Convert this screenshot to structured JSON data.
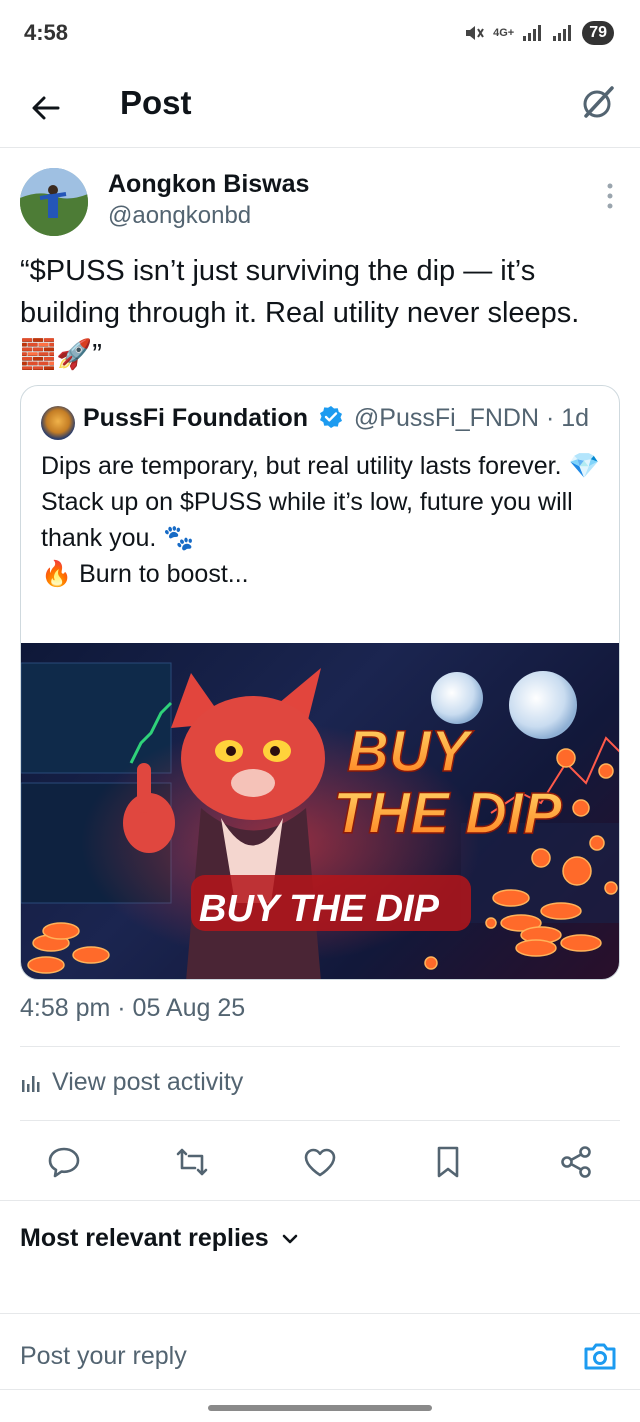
{
  "status_bar": {
    "time": "4:58",
    "network": "4G+",
    "battery": "79"
  },
  "header": {
    "title": "Post"
  },
  "post": {
    "author_name": "Aongkon Biswas",
    "author_handle": "@aongkonbd",
    "text": "“$PUSS isn’t just surviving the dip — it’s building through it. Real utility never sleeps. 🧱🚀”",
    "timestamp": "4:58 pm · 05 Aug 25"
  },
  "quoted_post": {
    "author_name": "PussFi Foundation",
    "author_handle": "@PussFi_FNDN",
    "age": "· 1d",
    "lines": [
      "Dips are temporary, but real utility lasts forever. 💎",
      "Stack up on $PUSS while it’s low, future you will thank you. 🐾",
      "🔥 Burn to boost..."
    ],
    "image": {
      "headline_line1": "BUY",
      "headline_line2": "THE DIP",
      "banner_text": "BUY THE DIP"
    }
  },
  "activity": {
    "label": "View post activity"
  },
  "replies": {
    "sort_label": "Most relevant replies"
  },
  "reply_input": {
    "placeholder": "Post your reply"
  },
  "colors": {
    "text_primary": "#0f1419",
    "text_secondary": "#536471",
    "accent": "#1d9bf0",
    "divider": "#e6e8ea"
  },
  "icons": {
    "back": "arrow-left-icon",
    "grok": "grok-icon",
    "more": "more-vertical-icon",
    "verified": "verified-badge-icon",
    "activity": "bar-chart-icon",
    "reply": "reply-icon",
    "repost": "repost-icon",
    "like": "heart-icon",
    "bookmark": "bookmark-icon",
    "share": "share-icon",
    "chevron": "chevron-down-icon",
    "camera": "camera-icon"
  }
}
